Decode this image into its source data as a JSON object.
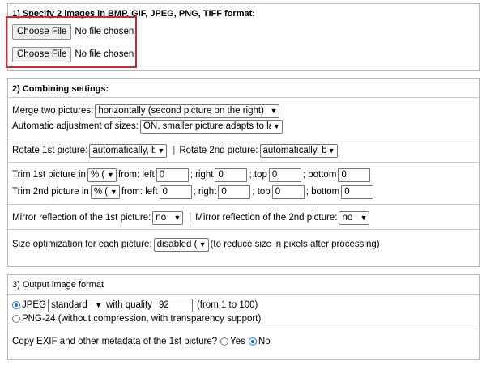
{
  "section1": {
    "title": "1) Specify 2 images in BMP, GIF, JPEG, PNG, TIFF format:",
    "file1": {
      "button": "Choose File",
      "status": "No file chosen"
    },
    "file2": {
      "button": "Choose File",
      "status": "No file chosen"
    }
  },
  "section2": {
    "title": "2) Combining settings:",
    "merge_label": "Merge two pictures:",
    "merge_value": "horizontally (second picture on the right)",
    "adjust_label": "Automatic adjustment of sizes:",
    "adjust_value": "ON, smaller picture adapts to la",
    "rotate1_label": "Rotate 1st picture:",
    "rotate1_value": "automatically, b",
    "rotate2_label": "Rotate 2nd picture:",
    "rotate2_value": "automatically, b",
    "trim1_label": "Trim 1st picture in",
    "trim1_unit": "% (",
    "trim2_label": "Trim 2nd picture in",
    "trim2_unit": "% (",
    "from_left": "from: left",
    "right": "; right",
    "top": "; top",
    "bottom": "; bottom",
    "trim1_values": {
      "left": "0",
      "right": "0",
      "top": "0",
      "bottom": "0"
    },
    "trim2_values": {
      "left": "0",
      "right": "0",
      "top": "0",
      "bottom": "0"
    },
    "mirror1_label": "Mirror reflection of the 1st picture:",
    "mirror1_value": "no",
    "mirror2_label": "Mirror reflection of the 2nd picture:",
    "mirror2_value": "no",
    "sizeopt_label": "Size optimization for each picture:",
    "sizeopt_value": "disabled (",
    "sizeopt_note": "(to reduce size in pixels after processing)"
  },
  "section3": {
    "title": "3) Output image format",
    "jpeg_label": "JPEG",
    "jpeg_mode": "standard",
    "quality_label": "with quality",
    "quality_value": "92",
    "quality_range": "(from 1 to 100)",
    "png_label": "PNG-24 (without compression, with transparency support)",
    "exif_label": "Copy EXIF and other metadata of the 1st picture?",
    "yes_label": "Yes",
    "no_label": "No"
  },
  "colors": {
    "highlight": "#d42a2a",
    "radio_selected": "#1a73e8"
  }
}
